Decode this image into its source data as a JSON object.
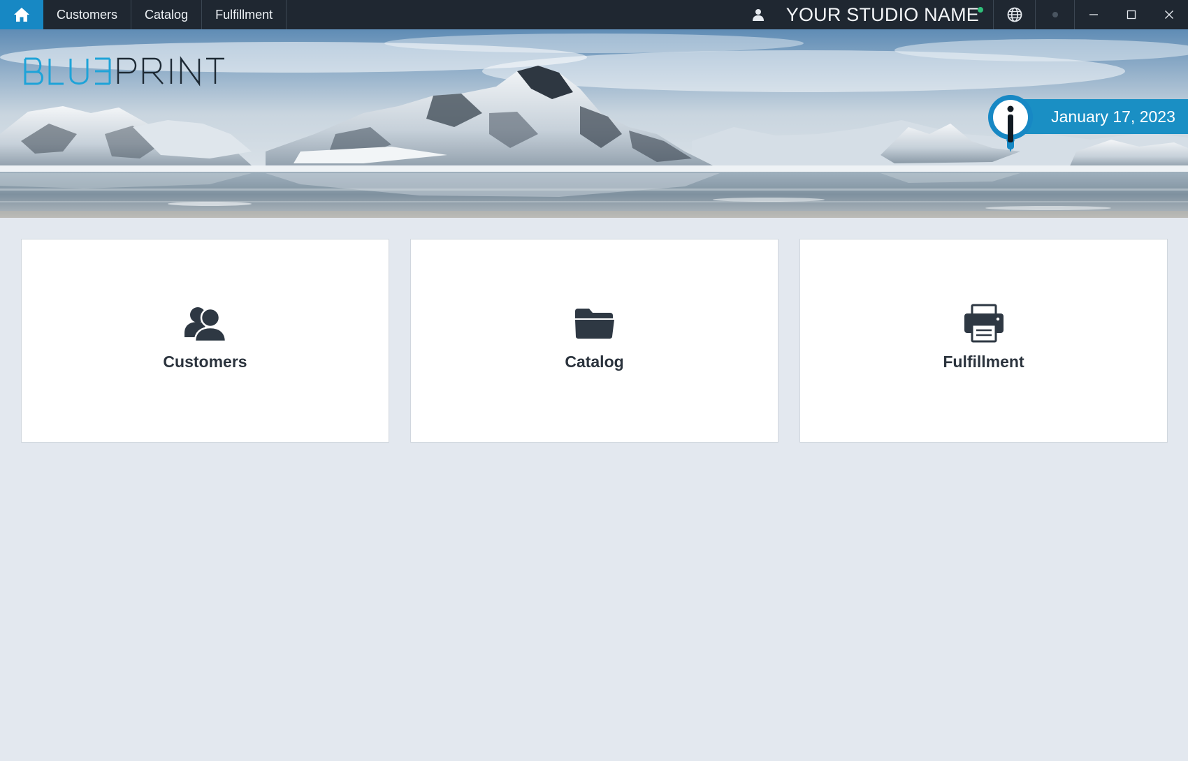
{
  "titlebar": {
    "nav_tabs": [
      {
        "label": "Customers"
      },
      {
        "label": "Catalog"
      },
      {
        "label": "Fulfillment"
      }
    ],
    "studio_name": "YOUR STUDIO NAME"
  },
  "banner": {
    "logo_text": "BLUEPRINT",
    "date": "January 17, 2023"
  },
  "cards": [
    {
      "label": "Customers",
      "icon": "users-icon"
    },
    {
      "label": "Catalog",
      "icon": "folder-icon"
    },
    {
      "label": "Fulfillment",
      "icon": "printer-icon"
    }
  ],
  "colors": {
    "accent": "#1788c4",
    "titlebar_bg": "#1f2731",
    "page_bg": "#e3e8ef",
    "status_online": "#2fc07a"
  }
}
